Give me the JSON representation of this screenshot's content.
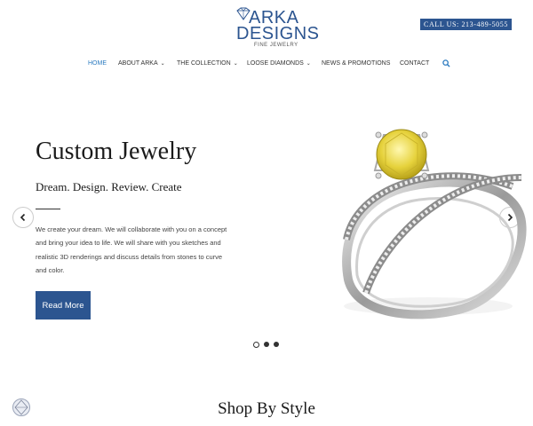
{
  "header": {
    "logo": {
      "line1": "ARKA",
      "line2": "DESIGNS",
      "line3": "FINE JEWELRY"
    },
    "call_label": "CALL US: 213-489-5055"
  },
  "nav": {
    "items": [
      {
        "label": "HOME",
        "active": true,
        "dropdown": false
      },
      {
        "label": "ABOUT ARKA",
        "active": false,
        "dropdown": true
      },
      {
        "label": "THE COLLECTION",
        "active": false,
        "dropdown": true
      },
      {
        "label": "LOOSE DIAMONDS",
        "active": false,
        "dropdown": true
      },
      {
        "label": "NEWS & PROMOTIONS",
        "active": false,
        "dropdown": false
      },
      {
        "label": "CONTACT",
        "active": false,
        "dropdown": false
      }
    ],
    "search_icon": "search-icon"
  },
  "hero": {
    "title": "Custom Jewelry",
    "subtitle": "Dream. Design. Review. Create",
    "description": "We create your dream. We will collaborate with you on a concept and bring your idea to life. We will share with you sketches and realistic 3D renderings and discuss details from stones to curve and color.",
    "button_label": "Read More",
    "slide_count": 3,
    "active_slide": 1
  },
  "section": {
    "title": "Shop By Style"
  },
  "colors": {
    "brand": "#2c5590",
    "nav_active": "#2c7bc0",
    "text": "#1a1a1a"
  }
}
